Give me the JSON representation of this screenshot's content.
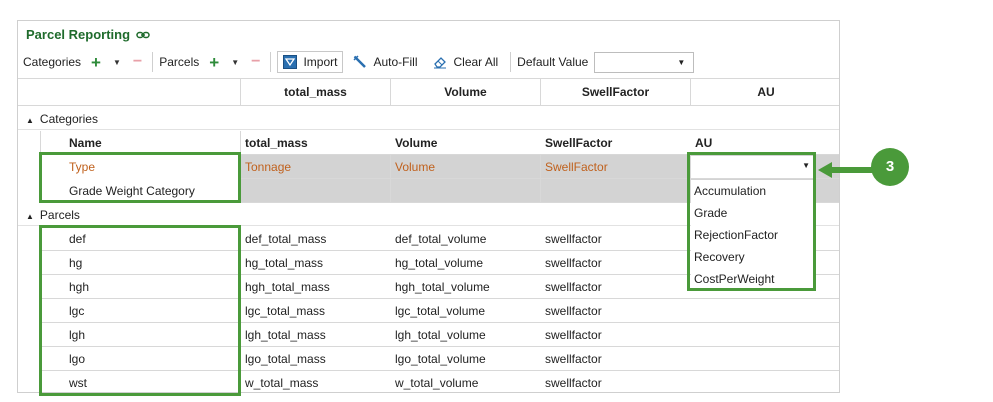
{
  "panel": {
    "title": "Parcel Reporting"
  },
  "toolbar": {
    "categories_label": "Categories",
    "parcels_label": "Parcels",
    "import_label": "Import",
    "autofill_label": "Auto-Fill",
    "clear_label": "Clear All",
    "default_value_label": "Default Value",
    "default_value": ""
  },
  "columns": {
    "total_mass": "total_mass",
    "volume": "Volume",
    "swell": "SwellFactor",
    "au": "AU"
  },
  "groups": {
    "categories": "Categories",
    "parcels": "Parcels"
  },
  "category_header": [
    "Name",
    "total_mass",
    "Volume",
    "SwellFactor",
    "AU"
  ],
  "category_rows": [
    {
      "name": "Type",
      "mass": "Tonnage",
      "volume": "Volume",
      "swell": "SwellFactor"
    },
    {
      "name": "Grade Weight Category",
      "mass": "",
      "volume": "",
      "swell": ""
    }
  ],
  "parcel_rows": [
    {
      "name": "def",
      "mass": "def_total_mass",
      "volume": "def_total_volume",
      "swell": "swellfactor"
    },
    {
      "name": "hg",
      "mass": "hg_total_mass",
      "volume": "hg_total_volume",
      "swell": "swellfactor"
    },
    {
      "name": "hgh",
      "mass": "hgh_total_mass",
      "volume": "hgh_total_volume",
      "swell": "swellfactor"
    },
    {
      "name": "lgc",
      "mass": "lgc_total_mass",
      "volume": "lgc_total_volume",
      "swell": "swellfactor"
    },
    {
      "name": "lgh",
      "mass": "lgh_total_mass",
      "volume": "lgh_total_volume",
      "swell": "swellfactor"
    },
    {
      "name": "lgo",
      "mass": "lgo_total_mass",
      "volume": "lgo_total_volume",
      "swell": "swellfactor"
    },
    {
      "name": "wst",
      "mass": "w_total_mass",
      "volume": "w_total_volume",
      "swell": "swellfactor"
    }
  ],
  "au_dropdown": {
    "value": "",
    "options": [
      "Accumulation",
      "Grade",
      "RejectionFactor",
      "Recovery",
      "CostPerWeight"
    ]
  },
  "callout": {
    "number": "3"
  },
  "colors": {
    "accent_green": "#4a9a3a",
    "title_green": "#1f6b2c",
    "orange_text": "#c0611d",
    "shaded_row": "#d3d3d3"
  },
  "icons": [
    "link-icon",
    "plus-icon",
    "caret-down-icon",
    "minus-icon",
    "import-icon",
    "auto-fill-icon",
    "eraser-icon",
    "expand-triangle-icon",
    "arrow-left-icon"
  ]
}
